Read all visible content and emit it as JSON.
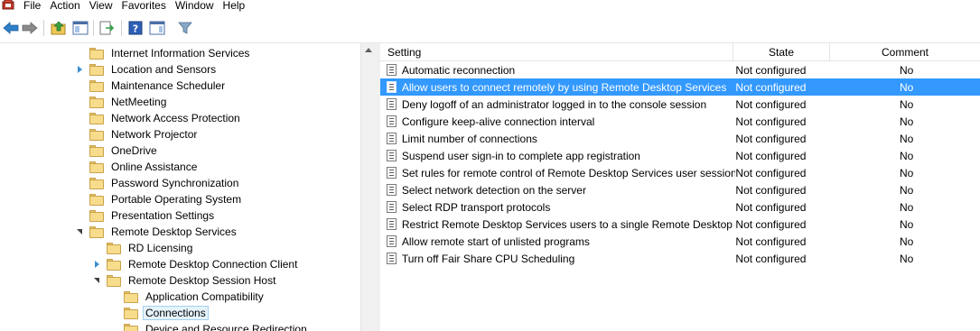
{
  "menu": {
    "items": [
      "File",
      "Action",
      "View",
      "Favorites",
      "Window",
      "Help"
    ]
  },
  "toolbar": {
    "buttons": [
      "back-icon",
      "forward-icon",
      "up-one-level-icon",
      "show-hide-console-tree-icon",
      "export-list-icon",
      "help-icon",
      "show-hide-action-pane-icon",
      "filter-icon"
    ]
  },
  "tree": {
    "items": [
      {
        "label": "Internet Information Services",
        "level": 0,
        "expander": "none"
      },
      {
        "label": "Location and Sensors",
        "level": 0,
        "expander": "collapsed"
      },
      {
        "label": "Maintenance Scheduler",
        "level": 0,
        "expander": "none"
      },
      {
        "label": "NetMeeting",
        "level": 0,
        "expander": "none"
      },
      {
        "label": "Network Access Protection",
        "level": 0,
        "expander": "none"
      },
      {
        "label": "Network Projector",
        "level": 0,
        "expander": "none"
      },
      {
        "label": "OneDrive",
        "level": 0,
        "expander": "none"
      },
      {
        "label": "Online Assistance",
        "level": 0,
        "expander": "none"
      },
      {
        "label": "Password Synchronization",
        "level": 0,
        "expander": "none"
      },
      {
        "label": "Portable Operating System",
        "level": 0,
        "expander": "none"
      },
      {
        "label": "Presentation Settings",
        "level": 0,
        "expander": "none"
      },
      {
        "label": "Remote Desktop Services",
        "level": 0,
        "expander": "expanded"
      },
      {
        "label": "RD Licensing",
        "level": 1,
        "expander": "none"
      },
      {
        "label": "Remote Desktop Connection Client",
        "level": 1,
        "expander": "collapsed"
      },
      {
        "label": "Remote Desktop Session Host",
        "level": 1,
        "expander": "expanded"
      },
      {
        "label": "Application Compatibility",
        "level": 2,
        "expander": "none"
      },
      {
        "label": "Connections",
        "level": 2,
        "expander": "none",
        "selected": true
      },
      {
        "label": "Device and Resource Redirection",
        "level": 2,
        "expander": "none"
      }
    ]
  },
  "list": {
    "headers": {
      "setting": "Setting",
      "state": "State",
      "comment": "Comment"
    },
    "rows": [
      {
        "setting": "Automatic reconnection",
        "state": "Not configured",
        "comment": "No"
      },
      {
        "setting": "Allow users to connect remotely by using Remote Desktop Services",
        "state": "Not configured",
        "comment": "No",
        "selected": true
      },
      {
        "setting": "Deny logoff of an administrator logged in to the console session",
        "state": "Not configured",
        "comment": "No"
      },
      {
        "setting": "Configure keep-alive connection interval",
        "state": "Not configured",
        "comment": "No"
      },
      {
        "setting": "Limit number of connections",
        "state": "Not configured",
        "comment": "No"
      },
      {
        "setting": "Suspend user sign-in to complete app registration",
        "state": "Not configured",
        "comment": "No"
      },
      {
        "setting": "Set rules for remote control of Remote Desktop Services user sessions",
        "state": "Not configured",
        "comment": "No"
      },
      {
        "setting": "Select network detection on the server",
        "state": "Not configured",
        "comment": "No"
      },
      {
        "setting": "Select RDP transport protocols",
        "state": "Not configured",
        "comment": "No"
      },
      {
        "setting": "Restrict Remote Desktop Services users to a single Remote Desktop ...",
        "state": "Not configured",
        "comment": "No"
      },
      {
        "setting": "Allow remote start of unlisted programs",
        "state": "Not configured",
        "comment": "No"
      },
      {
        "setting": "Turn off Fair Share CPU Scheduling",
        "state": "Not configured",
        "comment": "No"
      }
    ]
  },
  "colors": {
    "selection": "#3399ff",
    "tree_selection": "#e5f3fb",
    "folder": "#f7dc8c"
  }
}
